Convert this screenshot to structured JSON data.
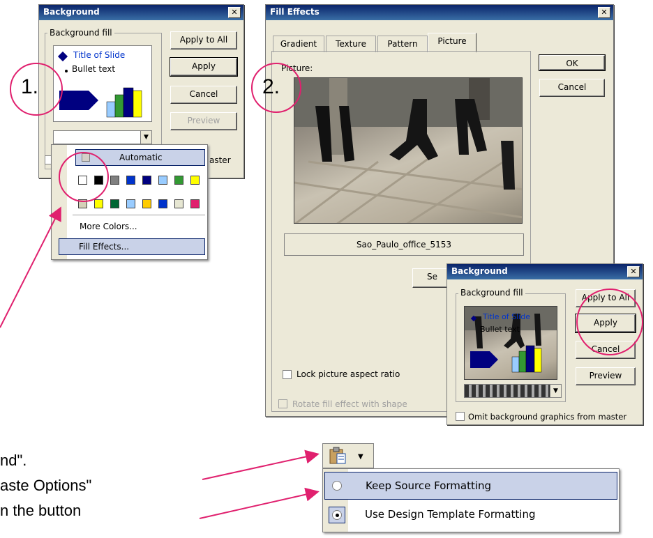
{
  "bg_dialog_1": {
    "title": "Background",
    "group_label": "Background fill",
    "preview_title": "Title of Slide",
    "preview_bullet": "Bullet text",
    "buttons": {
      "apply_all": "Apply to All",
      "apply": "Apply",
      "cancel": "Cancel",
      "preview": "Preview"
    },
    "omit_partial": "aster"
  },
  "color_menu": {
    "automatic": "Automatic",
    "more_colors": "More Colors...",
    "fill_effects": "Fill Effects...",
    "row1": [
      "#ffffff",
      "#000000",
      "#808080",
      "#0033cc",
      "#000080",
      "#99ccff",
      "#339933",
      "#ffff00"
    ],
    "row2": [
      "#d4d0b8",
      "#ffff00",
      "#006633",
      "#99ccff",
      "#ffcc00",
      "#0033cc",
      "#e6e6d2",
      "#e0206e"
    ]
  },
  "fill_effects": {
    "title": "Fill Effects",
    "tabs": [
      "Gradient",
      "Texture",
      "Pattern",
      "Picture"
    ],
    "picture_label": "Picture:",
    "filename": "Sao_Paulo_office_5153",
    "ok": "OK",
    "cancel": "Cancel",
    "select_partial": "Se",
    "lock_aspect": "Lock picture aspect ratio",
    "rotate_fill": "Rotate fill effect with shape"
  },
  "bg_dialog_2": {
    "title": "Background",
    "group_label": "Background fill",
    "preview_title": "Title of Slide",
    "preview_bullet": "Bullet text",
    "buttons": {
      "apply_all": "Apply to All",
      "apply": "Apply",
      "cancel": "Cancel",
      "preview": "Preview"
    },
    "omit": "Omit background graphics from master"
  },
  "paste_options": {
    "keep_source": "Keep Source Formatting",
    "use_design": "Use Design Template Formatting"
  },
  "annotations": {
    "step1": "1.",
    "step2": "2.",
    "text_line1": "nd\".",
    "text_line2": "aste Options\"",
    "text_line3": "n the button"
  }
}
